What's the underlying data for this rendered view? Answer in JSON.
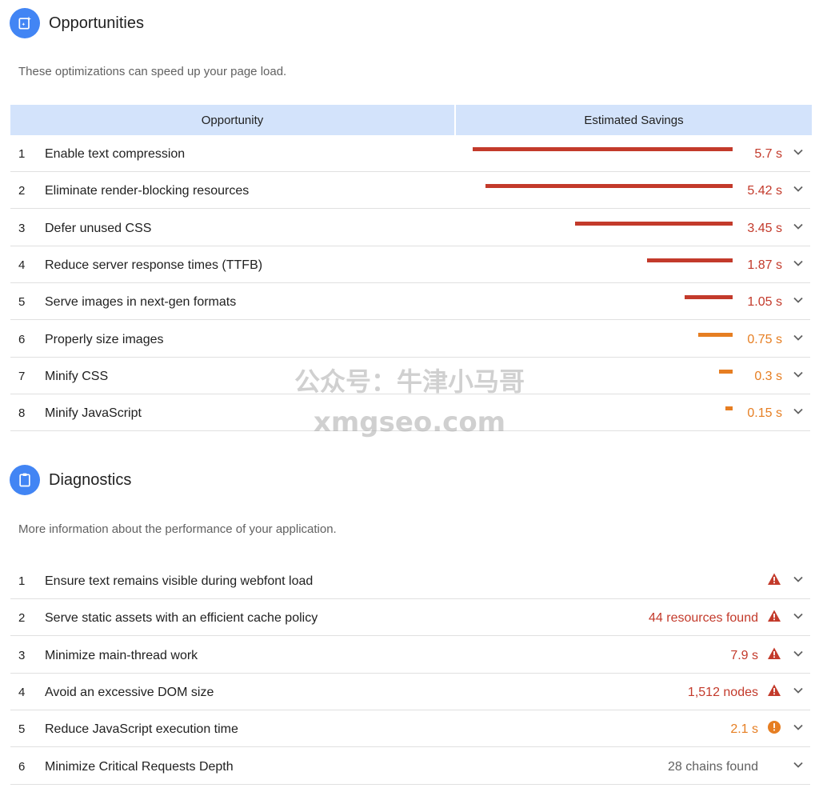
{
  "opportunities": {
    "title": "Opportunities",
    "description": "These optimizations can speed up your page load.",
    "col_opportunity": "Opportunity",
    "col_savings": "Estimated Savings",
    "items": [
      {
        "num": "1",
        "label": "Enable text compression",
        "value": "5.7 s",
        "savings": 5.7,
        "severity": "fail"
      },
      {
        "num": "2",
        "label": "Eliminate render-blocking resources",
        "value": "5.42 s",
        "savings": 5.42,
        "severity": "fail"
      },
      {
        "num": "3",
        "label": "Defer unused CSS",
        "value": "3.45 s",
        "savings": 3.45,
        "severity": "fail"
      },
      {
        "num": "4",
        "label": "Reduce server response times (TTFB)",
        "value": "1.87 s",
        "savings": 1.87,
        "severity": "fail"
      },
      {
        "num": "5",
        "label": "Serve images in next-gen formats",
        "value": "1.05 s",
        "savings": 1.05,
        "severity": "fail"
      },
      {
        "num": "6",
        "label": "Properly size images",
        "value": "0.75 s",
        "savings": 0.75,
        "severity": "average"
      },
      {
        "num": "7",
        "label": "Minify CSS",
        "value": "0.3 s",
        "savings": 0.3,
        "severity": "average"
      },
      {
        "num": "8",
        "label": "Minify JavaScript",
        "value": "0.15 s",
        "savings": 0.15,
        "severity": "average"
      }
    ]
  },
  "diagnostics": {
    "title": "Diagnostics",
    "description": "More information about the performance of your application.",
    "items": [
      {
        "num": "1",
        "label": "Ensure text remains visible during webfont load",
        "value": "",
        "status": "fail",
        "icon": "warning-triangle-icon"
      },
      {
        "num": "2",
        "label": "Serve static assets with an efficient cache policy",
        "value": "44 resources found",
        "status": "fail",
        "icon": "warning-triangle-icon"
      },
      {
        "num": "3",
        "label": "Minimize main-thread work",
        "value": "7.9 s",
        "status": "fail",
        "icon": "warning-triangle-icon"
      },
      {
        "num": "4",
        "label": "Avoid an excessive DOM size",
        "value": "1,512 nodes",
        "status": "fail",
        "icon": "warning-triangle-icon"
      },
      {
        "num": "5",
        "label": "Reduce JavaScript execution time",
        "value": "2.1 s",
        "status": "average",
        "icon": "info-circle-icon"
      },
      {
        "num": "6",
        "label": "Minimize Critical Requests Depth",
        "value": "28 chains found",
        "status": "neutral",
        "icon": ""
      }
    ]
  },
  "watermark": {
    "line1": "公众号：牛津小马哥",
    "line2": "xmgseo.com"
  },
  "colors": {
    "fail": "#c33a2b",
    "average": "#e67e22",
    "neutral": "#616161",
    "accent": "#4285f4",
    "header_bg": "#d3e3fb"
  }
}
